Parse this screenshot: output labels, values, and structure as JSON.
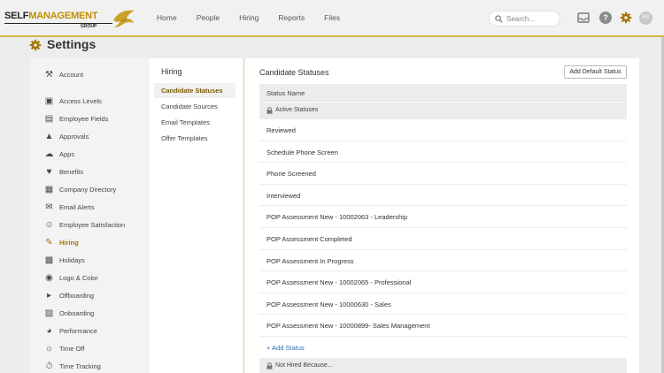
{
  "brand": {
    "logo_main": "SELF",
    "logo_accent": "MANAGEMENT",
    "logo_sub": "GROUP"
  },
  "nav": [
    "Home",
    "People",
    "Hiring",
    "Reports",
    "Files"
  ],
  "search": {
    "placeholder": "Search..."
  },
  "user": {
    "initials": "RS"
  },
  "page": {
    "title": "Settings"
  },
  "sidebar": {
    "items": [
      {
        "label": "Account",
        "icon": "wrench-icon"
      },
      {
        "label": "Access Levels",
        "icon": "lock-icon"
      },
      {
        "label": "Employee Fields",
        "icon": "fields-icon"
      },
      {
        "label": "Approvals",
        "icon": "thumbs-up-icon"
      },
      {
        "label": "Apps",
        "icon": "cloud-icon"
      },
      {
        "label": "Benefits",
        "icon": "heart-icon"
      },
      {
        "label": "Company Directory",
        "icon": "directory-icon"
      },
      {
        "label": "Email Alerts",
        "icon": "envelope-icon"
      },
      {
        "label": "Employee Satisfaction",
        "icon": "smile-icon"
      },
      {
        "label": "Hiring",
        "icon": "clipboard-icon",
        "active": true
      },
      {
        "label": "Holidays",
        "icon": "gift-icon"
      },
      {
        "label": "Logo & Color",
        "icon": "palette-icon"
      },
      {
        "label": "Offboarding",
        "icon": "offboarding-icon"
      },
      {
        "label": "Onboarding",
        "icon": "onboarding-icon"
      },
      {
        "label": "Performance",
        "icon": "gauge-icon"
      },
      {
        "label": "Time Off",
        "icon": "time-off-icon"
      },
      {
        "label": "Time Tracking",
        "icon": "stopwatch-icon"
      }
    ]
  },
  "subnav": {
    "heading": "Hiring",
    "items": [
      "Candidate Statuses",
      "Candidate Sources",
      "Email Templates",
      "Offer Templates"
    ],
    "active": "Candidate Statuses"
  },
  "content": {
    "title": "Candidate Statuses",
    "add_default_label": "Add Default Status",
    "column_header": "Status Name",
    "active_group": "Active Statuses",
    "statuses": [
      "Reviewed",
      "Schedule Phone Screen",
      "Phone Screened",
      "Interviewed",
      "POP Assessment New - 10002063 - Leadership",
      "POP Assessment Completed",
      "POP Assessment In Progress",
      "POP Assessment New - 10002065 - Professional",
      "POP Assessment New - 10000630 - Sales",
      "POP Assessment New - 10000899- Sales Management"
    ],
    "add_status_label": "+ Add Status",
    "not_hired_group": "Not Hired Because..."
  },
  "colors": {
    "accent": "#d8b24a",
    "active_text": "#a47400",
    "link": "#2f6fb0"
  }
}
